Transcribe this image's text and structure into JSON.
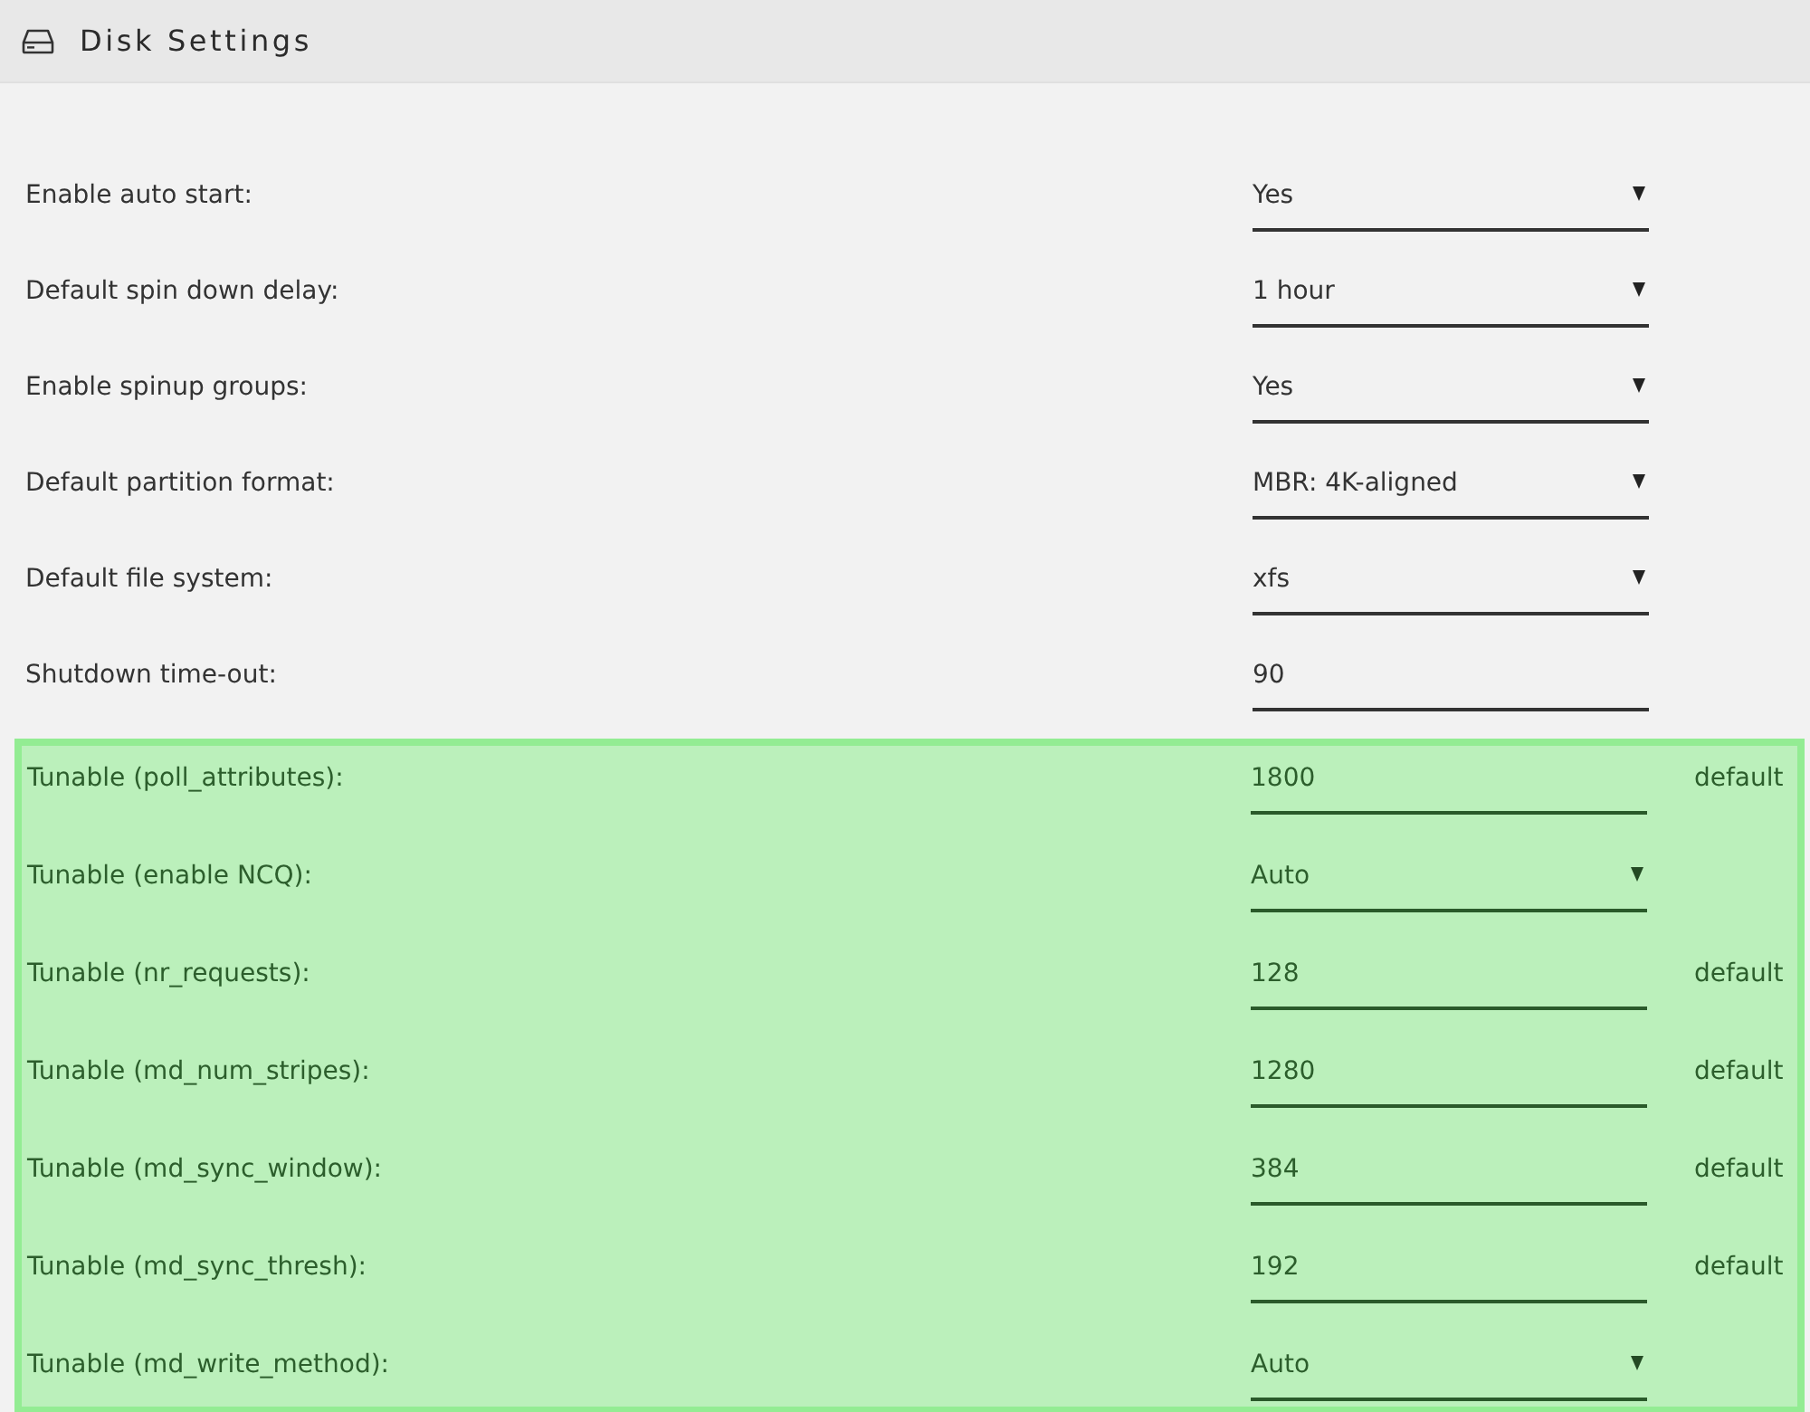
{
  "header": {
    "title": "Disk Settings"
  },
  "sections": [
    {
      "highlighted": false,
      "rows": [
        {
          "label": "Enable auto start:",
          "kind": "select",
          "value": "Yes"
        },
        {
          "label": "Default spin down delay:",
          "kind": "select",
          "value": "1 hour"
        },
        {
          "label": "Enable spinup groups:",
          "kind": "select",
          "value": "Yes"
        },
        {
          "label": "Default partition format:",
          "kind": "select",
          "value": "MBR: 4K-aligned"
        },
        {
          "label": "Default file system:",
          "kind": "select",
          "value": "xfs"
        },
        {
          "label": "Shutdown time-out:",
          "kind": "input",
          "value": "90"
        }
      ]
    },
    {
      "highlighted": true,
      "rows": [
        {
          "label": "Tunable (poll_attributes):",
          "kind": "input",
          "value": "1800",
          "note": "default"
        },
        {
          "label": "Tunable (enable NCQ):",
          "kind": "select",
          "value": "Auto"
        },
        {
          "label": "Tunable (nr_requests):",
          "kind": "input",
          "value": "128",
          "note": "default"
        },
        {
          "label": "Tunable (md_num_stripes):",
          "kind": "input",
          "value": "1280",
          "note": "default"
        },
        {
          "label": "Tunable (md_sync_window):",
          "kind": "input",
          "value": "384",
          "note": "default"
        },
        {
          "label": "Tunable (md_sync_thresh):",
          "kind": "input",
          "value": "192",
          "note": "default"
        },
        {
          "label": "Tunable (md_write_method):",
          "kind": "select",
          "value": "Auto"
        }
      ]
    }
  ]
}
